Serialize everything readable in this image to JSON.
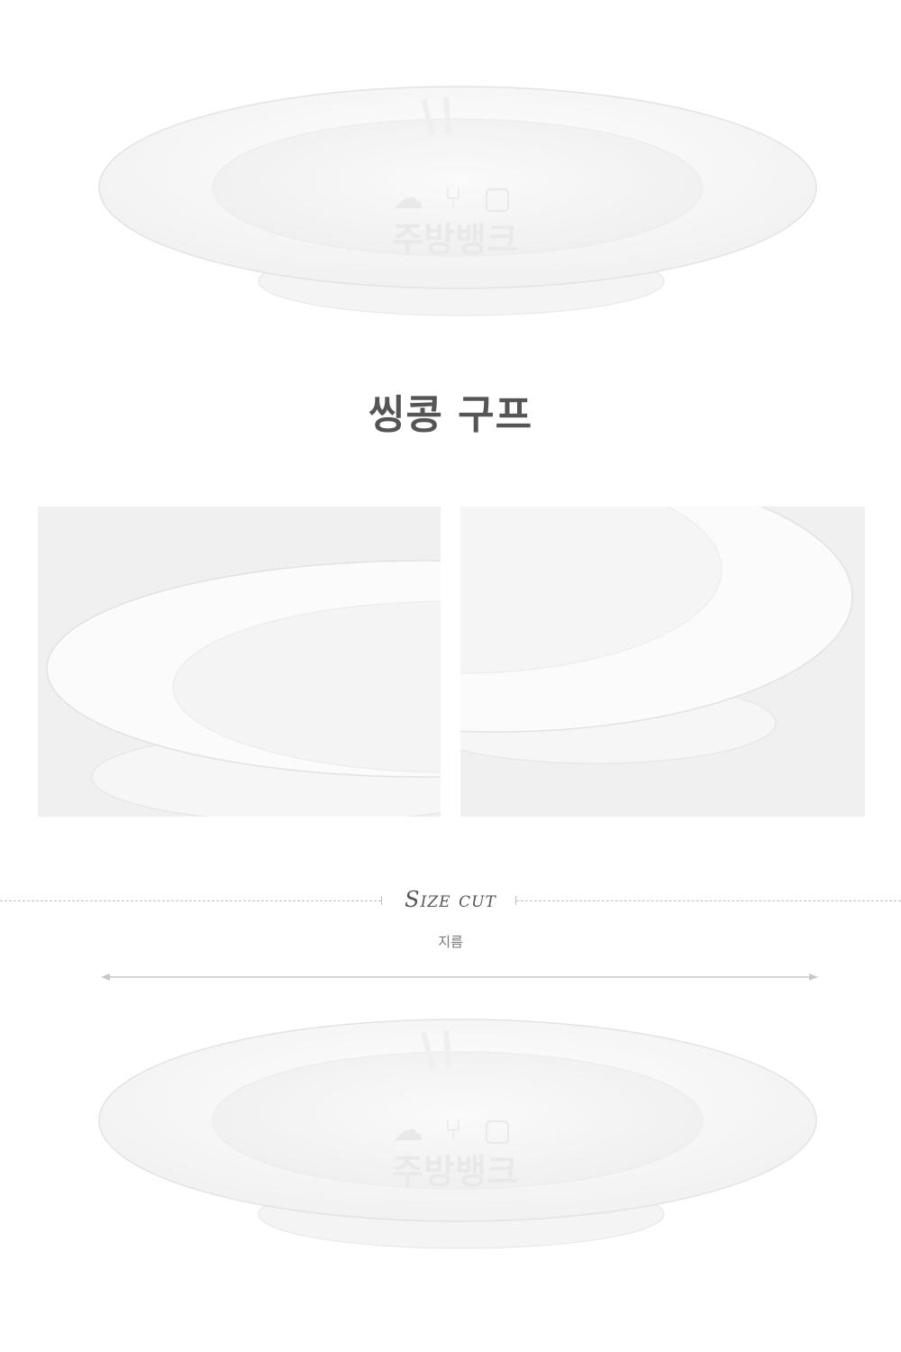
{
  "product": {
    "title": "씽콩 구프"
  },
  "watermark": {
    "brand": "주방뱅크"
  },
  "size_section": {
    "heading": "Size cut",
    "dimension_label": "지름"
  }
}
